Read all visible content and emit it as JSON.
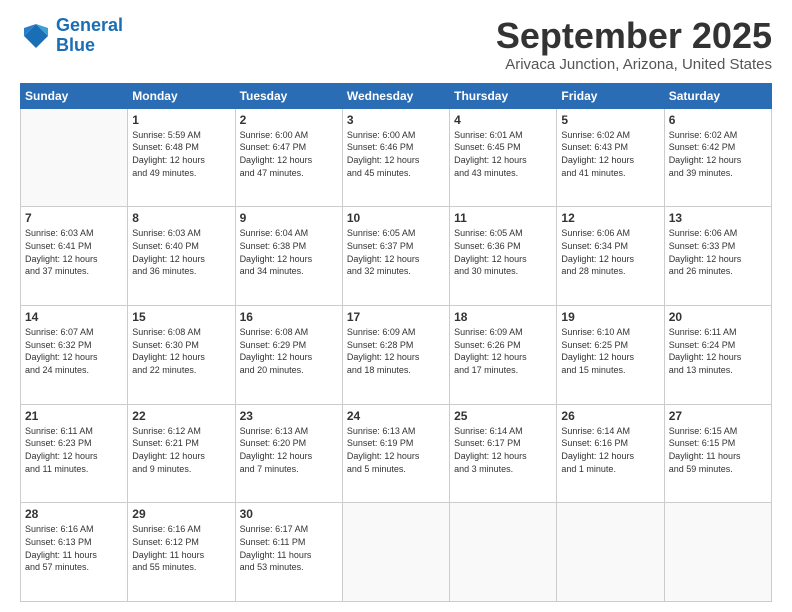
{
  "logo": {
    "line1": "General",
    "line2": "Blue"
  },
  "header": {
    "month": "September 2025",
    "location": "Arivaca Junction, Arizona, United States"
  },
  "weekdays": [
    "Sunday",
    "Monday",
    "Tuesday",
    "Wednesday",
    "Thursday",
    "Friday",
    "Saturday"
  ],
  "weeks": [
    [
      {
        "day": "",
        "info": ""
      },
      {
        "day": "1",
        "info": "Sunrise: 5:59 AM\nSunset: 6:48 PM\nDaylight: 12 hours\nand 49 minutes."
      },
      {
        "day": "2",
        "info": "Sunrise: 6:00 AM\nSunset: 6:47 PM\nDaylight: 12 hours\nand 47 minutes."
      },
      {
        "day": "3",
        "info": "Sunrise: 6:00 AM\nSunset: 6:46 PM\nDaylight: 12 hours\nand 45 minutes."
      },
      {
        "day": "4",
        "info": "Sunrise: 6:01 AM\nSunset: 6:45 PM\nDaylight: 12 hours\nand 43 minutes."
      },
      {
        "day": "5",
        "info": "Sunrise: 6:02 AM\nSunset: 6:43 PM\nDaylight: 12 hours\nand 41 minutes."
      },
      {
        "day": "6",
        "info": "Sunrise: 6:02 AM\nSunset: 6:42 PM\nDaylight: 12 hours\nand 39 minutes."
      }
    ],
    [
      {
        "day": "7",
        "info": "Sunrise: 6:03 AM\nSunset: 6:41 PM\nDaylight: 12 hours\nand 37 minutes."
      },
      {
        "day": "8",
        "info": "Sunrise: 6:03 AM\nSunset: 6:40 PM\nDaylight: 12 hours\nand 36 minutes."
      },
      {
        "day": "9",
        "info": "Sunrise: 6:04 AM\nSunset: 6:38 PM\nDaylight: 12 hours\nand 34 minutes."
      },
      {
        "day": "10",
        "info": "Sunrise: 6:05 AM\nSunset: 6:37 PM\nDaylight: 12 hours\nand 32 minutes."
      },
      {
        "day": "11",
        "info": "Sunrise: 6:05 AM\nSunset: 6:36 PM\nDaylight: 12 hours\nand 30 minutes."
      },
      {
        "day": "12",
        "info": "Sunrise: 6:06 AM\nSunset: 6:34 PM\nDaylight: 12 hours\nand 28 minutes."
      },
      {
        "day": "13",
        "info": "Sunrise: 6:06 AM\nSunset: 6:33 PM\nDaylight: 12 hours\nand 26 minutes."
      }
    ],
    [
      {
        "day": "14",
        "info": "Sunrise: 6:07 AM\nSunset: 6:32 PM\nDaylight: 12 hours\nand 24 minutes."
      },
      {
        "day": "15",
        "info": "Sunrise: 6:08 AM\nSunset: 6:30 PM\nDaylight: 12 hours\nand 22 minutes."
      },
      {
        "day": "16",
        "info": "Sunrise: 6:08 AM\nSunset: 6:29 PM\nDaylight: 12 hours\nand 20 minutes."
      },
      {
        "day": "17",
        "info": "Sunrise: 6:09 AM\nSunset: 6:28 PM\nDaylight: 12 hours\nand 18 minutes."
      },
      {
        "day": "18",
        "info": "Sunrise: 6:09 AM\nSunset: 6:26 PM\nDaylight: 12 hours\nand 17 minutes."
      },
      {
        "day": "19",
        "info": "Sunrise: 6:10 AM\nSunset: 6:25 PM\nDaylight: 12 hours\nand 15 minutes."
      },
      {
        "day": "20",
        "info": "Sunrise: 6:11 AM\nSunset: 6:24 PM\nDaylight: 12 hours\nand 13 minutes."
      }
    ],
    [
      {
        "day": "21",
        "info": "Sunrise: 6:11 AM\nSunset: 6:23 PM\nDaylight: 12 hours\nand 11 minutes."
      },
      {
        "day": "22",
        "info": "Sunrise: 6:12 AM\nSunset: 6:21 PM\nDaylight: 12 hours\nand 9 minutes."
      },
      {
        "day": "23",
        "info": "Sunrise: 6:13 AM\nSunset: 6:20 PM\nDaylight: 12 hours\nand 7 minutes."
      },
      {
        "day": "24",
        "info": "Sunrise: 6:13 AM\nSunset: 6:19 PM\nDaylight: 12 hours\nand 5 minutes."
      },
      {
        "day": "25",
        "info": "Sunrise: 6:14 AM\nSunset: 6:17 PM\nDaylight: 12 hours\nand 3 minutes."
      },
      {
        "day": "26",
        "info": "Sunrise: 6:14 AM\nSunset: 6:16 PM\nDaylight: 12 hours\nand 1 minute."
      },
      {
        "day": "27",
        "info": "Sunrise: 6:15 AM\nSunset: 6:15 PM\nDaylight: 11 hours\nand 59 minutes."
      }
    ],
    [
      {
        "day": "28",
        "info": "Sunrise: 6:16 AM\nSunset: 6:13 PM\nDaylight: 11 hours\nand 57 minutes."
      },
      {
        "day": "29",
        "info": "Sunrise: 6:16 AM\nSunset: 6:12 PM\nDaylight: 11 hours\nand 55 minutes."
      },
      {
        "day": "30",
        "info": "Sunrise: 6:17 AM\nSunset: 6:11 PM\nDaylight: 11 hours\nand 53 minutes."
      },
      {
        "day": "",
        "info": ""
      },
      {
        "day": "",
        "info": ""
      },
      {
        "day": "",
        "info": ""
      },
      {
        "day": "",
        "info": ""
      }
    ]
  ]
}
